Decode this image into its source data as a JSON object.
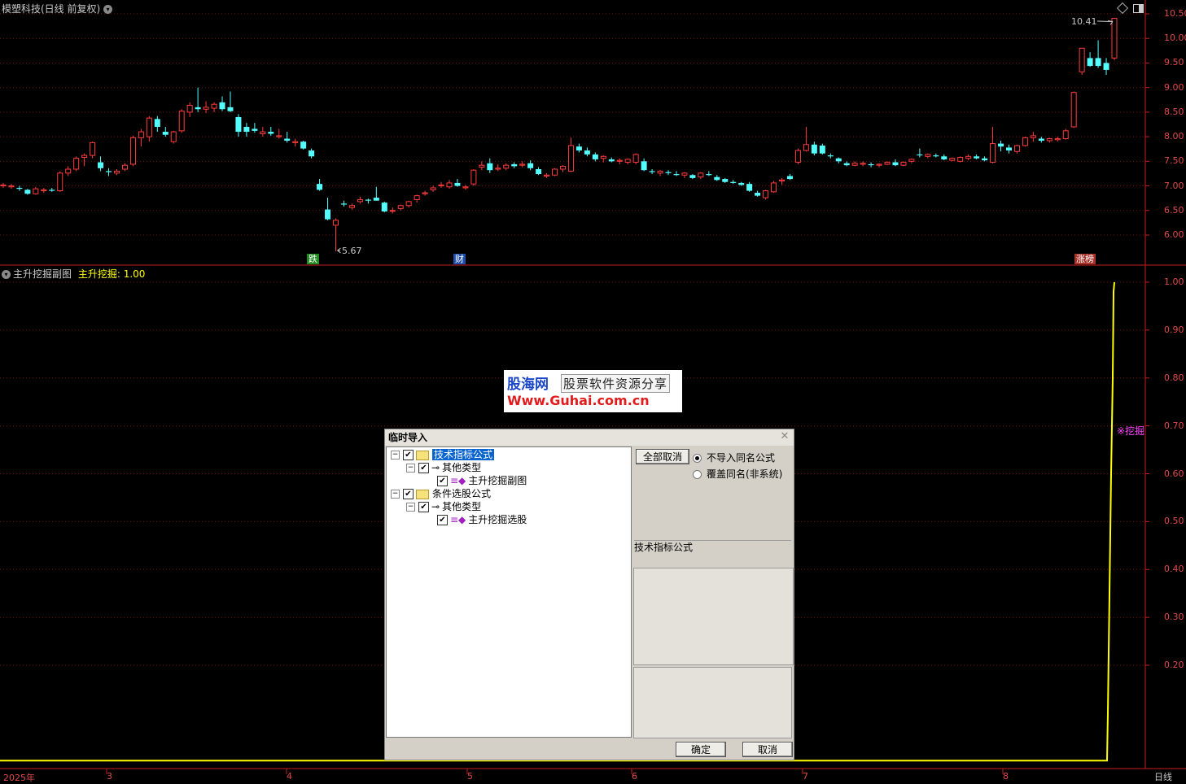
{
  "main": {
    "title": "模塑科技(日线 前复权)",
    "y_ticks": [
      "10.50",
      "10.00",
      "9.50",
      "9.00",
      "8.50",
      "8.00",
      "7.50",
      "7.00",
      "6.50",
      "6.00"
    ],
    "high_label": "10.41",
    "low_label": "5.67",
    "badges": [
      {
        "text": "跌",
        "color": "#1f8a1f"
      },
      {
        "text": "财",
        "color": "#1f4fa8"
      },
      {
        "text": "涨榜",
        "color": "#a8322a"
      }
    ]
  },
  "sub": {
    "title": "主升挖掘副图",
    "indicator": "主升挖掘: 1.00",
    "y_ticks": [
      "1.00",
      "0.90",
      "0.80",
      "0.70",
      "0.60",
      "0.50",
      "0.40",
      "0.30",
      "0.20"
    ],
    "signal_label": "※挖掘"
  },
  "x_axis": {
    "labels": [
      "2025年",
      "3",
      "4",
      "5",
      "6",
      "7",
      "8"
    ],
    "period": "日线"
  },
  "watermark": {
    "site_name": "股海网",
    "slogan": "股票软件资源分享",
    "url": "Www.Guhai.com.cn"
  },
  "dialog": {
    "title": "临时导入",
    "tree": [
      {
        "label": "技术指标公式",
        "level": 0,
        "selected": true
      },
      {
        "label": "其他类型",
        "level": 1
      },
      {
        "label": "主升挖掘副图",
        "level": 2
      },
      {
        "label": "条件选股公式",
        "level": 0
      },
      {
        "label": "其他类型",
        "level": 1
      },
      {
        "label": "主升挖掘选股",
        "level": 2
      }
    ],
    "cancel_all": "全部取消",
    "radio_skip": "不导入同名公式",
    "radio_overwrite": "覆盖同名(非系统)",
    "info_label": "技术指标公式",
    "ok": "确定",
    "cancel": "取消"
  },
  "colors": {
    "up": "#ff3c3c",
    "down": "#54ffff",
    "indicator": "#ffff00",
    "grid": "#7a1010",
    "axis": "#c81e1e"
  },
  "chart_data": {
    "type": "candlestick",
    "ohlc": [
      [
        7.0,
        7.06,
        6.96,
        7.02
      ],
      [
        6.98,
        7.04,
        6.94,
        7.0
      ],
      [
        6.96,
        7.0,
        6.9,
        6.94
      ],
      [
        6.92,
        6.94,
        6.82,
        6.84
      ],
      [
        6.84,
        6.98,
        6.82,
        6.94
      ],
      [
        6.9,
        6.96,
        6.86,
        6.92
      ],
      [
        6.92,
        6.96,
        6.88,
        6.9
      ],
      [
        6.9,
        7.3,
        6.88,
        7.26
      ],
      [
        7.26,
        7.4,
        7.2,
        7.34
      ],
      [
        7.34,
        7.6,
        7.3,
        7.56
      ],
      [
        7.58,
        7.66,
        7.4,
        7.62
      ],
      [
        7.62,
        7.9,
        7.56,
        7.88
      ],
      [
        7.48,
        7.6,
        7.3,
        7.36
      ],
      [
        7.3,
        7.36,
        7.2,
        7.28
      ],
      [
        7.26,
        7.34,
        7.22,
        7.3
      ],
      [
        7.34,
        7.46,
        7.3,
        7.42
      ],
      [
        7.44,
        8.02,
        7.4,
        7.98
      ],
      [
        7.98,
        8.16,
        7.8,
        8.1
      ],
      [
        8.0,
        8.42,
        7.9,
        8.38
      ],
      [
        8.36,
        8.42,
        8.1,
        8.2
      ],
      [
        8.1,
        8.2,
        8.0,
        8.04
      ],
      [
        7.9,
        8.12,
        7.86,
        8.1
      ],
      [
        8.12,
        8.56,
        8.08,
        8.52
      ],
      [
        8.5,
        8.7,
        8.4,
        8.64
      ],
      [
        8.6,
        9.0,
        8.5,
        8.56
      ],
      [
        8.56,
        8.72,
        8.48,
        8.6
      ],
      [
        8.58,
        8.7,
        8.5,
        8.66
      ],
      [
        8.7,
        8.82,
        8.52,
        8.56
      ],
      [
        8.6,
        8.92,
        8.5,
        8.52
      ],
      [
        8.4,
        8.46,
        8.0,
        8.1
      ],
      [
        8.2,
        8.28,
        8.0,
        8.1
      ],
      [
        8.16,
        8.28,
        8.08,
        8.12
      ],
      [
        8.06,
        8.2,
        8.0,
        8.1
      ],
      [
        8.1,
        8.2,
        8.02,
        8.06
      ],
      [
        8.0,
        8.16,
        7.96,
        8.02
      ],
      [
        7.96,
        8.1,
        7.88,
        7.92
      ],
      [
        7.88,
        7.96,
        7.8,
        7.9
      ],
      [
        7.9,
        7.92,
        7.74,
        7.76
      ],
      [
        7.72,
        7.76,
        7.56,
        7.6
      ],
      [
        7.04,
        7.14,
        6.9,
        6.92
      ],
      [
        6.52,
        6.76,
        6.3,
        6.32
      ],
      [
        6.2,
        6.34,
        5.67,
        6.3
      ],
      [
        6.64,
        6.7,
        6.58,
        6.62
      ],
      [
        6.56,
        6.64,
        6.52,
        6.6
      ],
      [
        6.68,
        6.78,
        6.64,
        6.72
      ],
      [
        6.72,
        6.74,
        6.64,
        6.7
      ],
      [
        6.76,
        6.98,
        6.7,
        6.7
      ],
      [
        6.66,
        6.68,
        6.46,
        6.48
      ],
      [
        6.5,
        6.56,
        6.44,
        6.5
      ],
      [
        6.54,
        6.62,
        6.5,
        6.6
      ],
      [
        6.6,
        6.7,
        6.56,
        6.68
      ],
      [
        6.72,
        6.82,
        6.66,
        6.8
      ],
      [
        6.84,
        6.9,
        6.8,
        6.86
      ],
      [
        6.92,
        7.0,
        6.88,
        6.96
      ],
      [
        7.0,
        7.08,
        6.96,
        7.02
      ],
      [
        6.98,
        7.12,
        6.94,
        7.06
      ],
      [
        7.06,
        7.14,
        6.98,
        7.0
      ],
      [
        6.96,
        7.02,
        6.92,
        6.98
      ],
      [
        7.04,
        7.34,
        7.0,
        7.32
      ],
      [
        7.38,
        7.5,
        7.32,
        7.42
      ],
      [
        7.46,
        7.56,
        7.26,
        7.32
      ],
      [
        7.34,
        7.44,
        7.3,
        7.36
      ],
      [
        7.36,
        7.46,
        7.32,
        7.42
      ],
      [
        7.44,
        7.48,
        7.36,
        7.4
      ],
      [
        7.42,
        7.5,
        7.38,
        7.44
      ],
      [
        7.46,
        7.52,
        7.32,
        7.36
      ],
      [
        7.34,
        7.38,
        7.22,
        7.24
      ],
      [
        7.2,
        7.26,
        7.16,
        7.22
      ],
      [
        7.22,
        7.36,
        7.2,
        7.34
      ],
      [
        7.34,
        7.42,
        7.28,
        7.4
      ],
      [
        7.3,
        7.98,
        7.28,
        7.82
      ],
      [
        7.8,
        7.86,
        7.68,
        7.72
      ],
      [
        7.72,
        7.78,
        7.6,
        7.64
      ],
      [
        7.64,
        7.68,
        7.5,
        7.54
      ],
      [
        7.56,
        7.62,
        7.48,
        7.6
      ],
      [
        7.54,
        7.58,
        7.48,
        7.5
      ],
      [
        7.5,
        7.56,
        7.44,
        7.52
      ],
      [
        7.48,
        7.56,
        7.44,
        7.54
      ],
      [
        7.48,
        7.66,
        7.44,
        7.64
      ],
      [
        7.5,
        7.56,
        7.3,
        7.32
      ],
      [
        7.3,
        7.34,
        7.24,
        7.28
      ],
      [
        7.26,
        7.32,
        7.2,
        7.3
      ],
      [
        7.28,
        7.32,
        7.22,
        7.26
      ],
      [
        7.24,
        7.3,
        7.2,
        7.22
      ],
      [
        7.22,
        7.28,
        7.16,
        7.26
      ],
      [
        7.22,
        7.24,
        7.14,
        7.16
      ],
      [
        7.18,
        7.28,
        7.14,
        7.26
      ],
      [
        7.24,
        7.3,
        7.2,
        7.22
      ],
      [
        7.18,
        7.22,
        7.1,
        7.12
      ],
      [
        7.14,
        7.16,
        7.06,
        7.08
      ],
      [
        7.08,
        7.12,
        7.04,
        7.06
      ],
      [
        7.06,
        7.08,
        7.0,
        7.02
      ],
      [
        7.04,
        7.08,
        6.88,
        6.9
      ],
      [
        6.86,
        6.9,
        6.78,
        6.8
      ],
      [
        6.76,
        6.92,
        6.72,
        6.9
      ],
      [
        6.88,
        7.1,
        6.86,
        7.06
      ],
      [
        7.1,
        7.16,
        7.02,
        7.12
      ],
      [
        7.2,
        7.24,
        7.12,
        7.14
      ],
      [
        7.48,
        7.76,
        7.44,
        7.72
      ],
      [
        7.72,
        8.2,
        7.7,
        7.84
      ],
      [
        7.84,
        7.9,
        7.62,
        7.66
      ],
      [
        7.82,
        7.86,
        7.64,
        7.66
      ],
      [
        7.62,
        7.66,
        7.56,
        7.6
      ],
      [
        7.56,
        7.58,
        7.46,
        7.5
      ],
      [
        7.46,
        7.5,
        7.4,
        7.42
      ],
      [
        7.42,
        7.5,
        7.4,
        7.46
      ],
      [
        7.44,
        7.5,
        7.4,
        7.46
      ],
      [
        7.44,
        7.48,
        7.38,
        7.42
      ],
      [
        7.42,
        7.46,
        7.38,
        7.44
      ],
      [
        7.44,
        7.5,
        7.42,
        7.48
      ],
      [
        7.48,
        7.54,
        7.4,
        7.42
      ],
      [
        7.42,
        7.5,
        7.4,
        7.48
      ],
      [
        7.5,
        7.56,
        7.46,
        7.54
      ],
      [
        7.64,
        7.76,
        7.58,
        7.62
      ],
      [
        7.6,
        7.66,
        7.56,
        7.64
      ],
      [
        7.62,
        7.66,
        7.58,
        7.6
      ],
      [
        7.6,
        7.64,
        7.52,
        7.54
      ],
      [
        7.52,
        7.58,
        7.5,
        7.56
      ],
      [
        7.5,
        7.6,
        7.48,
        7.58
      ],
      [
        7.56,
        7.64,
        7.52,
        7.6
      ],
      [
        7.6,
        7.64,
        7.54,
        7.56
      ],
      [
        7.56,
        7.6,
        7.5,
        7.52
      ],
      [
        7.48,
        8.2,
        7.46,
        7.86
      ],
      [
        7.86,
        7.92,
        7.7,
        7.8
      ],
      [
        7.78,
        7.84,
        7.66,
        7.72
      ],
      [
        7.7,
        7.84,
        7.66,
        7.82
      ],
      [
        7.82,
        8.0,
        7.8,
        7.98
      ],
      [
        7.98,
        8.1,
        7.9,
        8.02
      ],
      [
        7.96,
        8.0,
        7.88,
        7.92
      ],
      [
        7.92,
        7.98,
        7.88,
        7.96
      ],
      [
        7.94,
        8.0,
        7.9,
        7.96
      ],
      [
        7.96,
        8.16,
        7.94,
        8.12
      ],
      [
        8.2,
        8.92,
        8.18,
        8.9
      ],
      [
        9.32,
        9.8,
        9.26,
        9.8
      ],
      [
        9.6,
        9.72,
        9.42,
        9.44
      ],
      [
        9.6,
        9.96,
        9.4,
        9.44
      ],
      [
        9.5,
        9.6,
        9.26,
        9.36
      ],
      [
        9.6,
        10.41,
        9.56,
        10.41
      ]
    ],
    "y_range": [
      5.67,
      10.41
    ],
    "high": 10.41,
    "low": 5.67,
    "indicator": {
      "name": "主升挖掘",
      "type": "line",
      "value_last": 1.0,
      "y_range": [
        0.0,
        1.0
      ]
    }
  }
}
